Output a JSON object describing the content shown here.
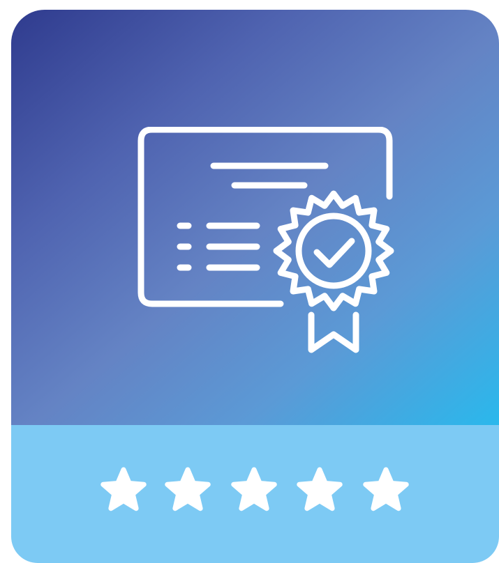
{
  "card": {
    "top_gradient": [
      "#2f3b8e",
      "#6483c4",
      "#2ab8ec"
    ],
    "bottom_color": "#7dcaf4",
    "icon_name": "certificate-award-icon",
    "icon_color": "#ffffff"
  },
  "rating": {
    "value": 5,
    "max": 5,
    "star_icon": "star-icon",
    "star_color": "#ffffff"
  }
}
